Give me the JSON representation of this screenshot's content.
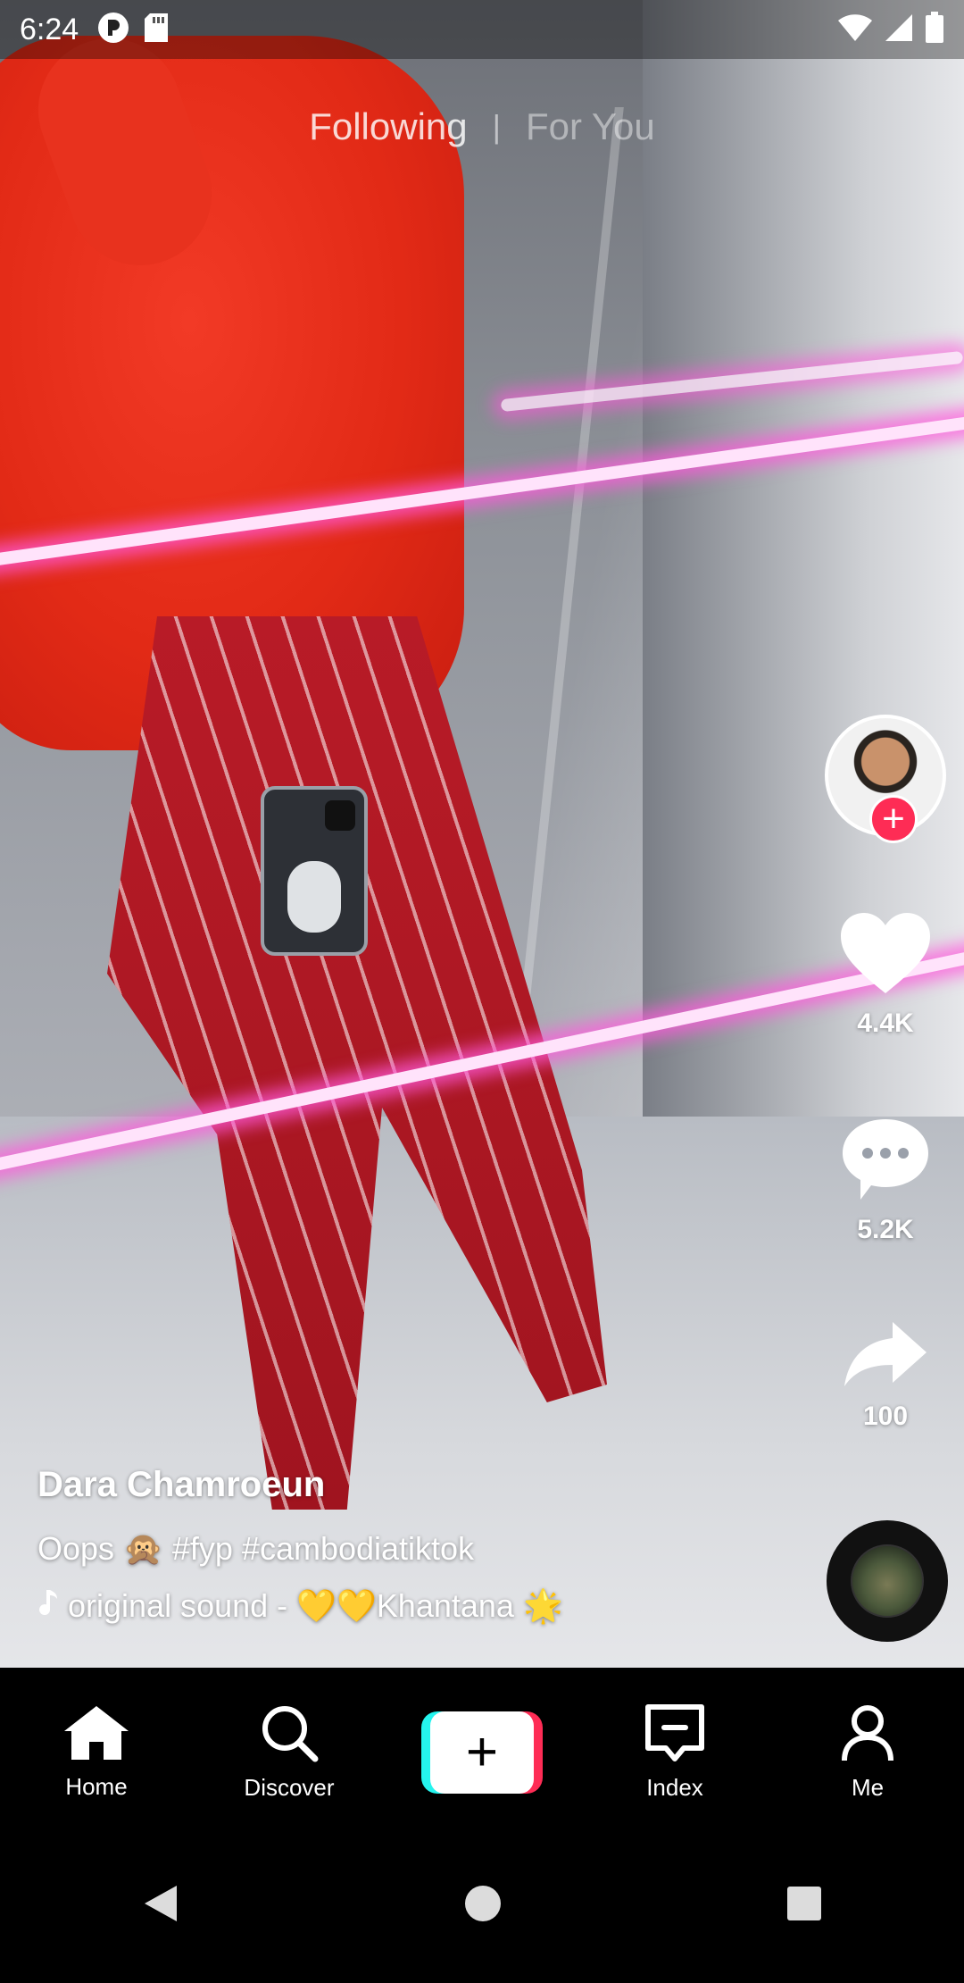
{
  "status_bar": {
    "time": "6:24",
    "left_icons": [
      "app-notification-icon",
      "sd-card-icon"
    ],
    "right_icons": [
      "wifi-icon",
      "cellular-signal-icon",
      "battery-icon"
    ]
  },
  "top_tabs": {
    "following": "Following",
    "divider": "|",
    "for_you": "For You"
  },
  "video": {
    "username": "Dara Chamroeun",
    "description": "Oops 🙊 #fyp #cambodiatiktok",
    "sound": "original sound - 💛💛Khantana 🌟"
  },
  "actions": {
    "likes": "4.4K",
    "comments": "5.2K",
    "shares": "100",
    "follow_symbol": "+"
  },
  "bottom_nav": {
    "home": "Home",
    "discover": "Discover",
    "create_symbol": "+",
    "index": "Index",
    "me": "Me"
  },
  "colors": {
    "accent_red": "#fe2c55",
    "accent_cyan": "#25f4ee"
  }
}
